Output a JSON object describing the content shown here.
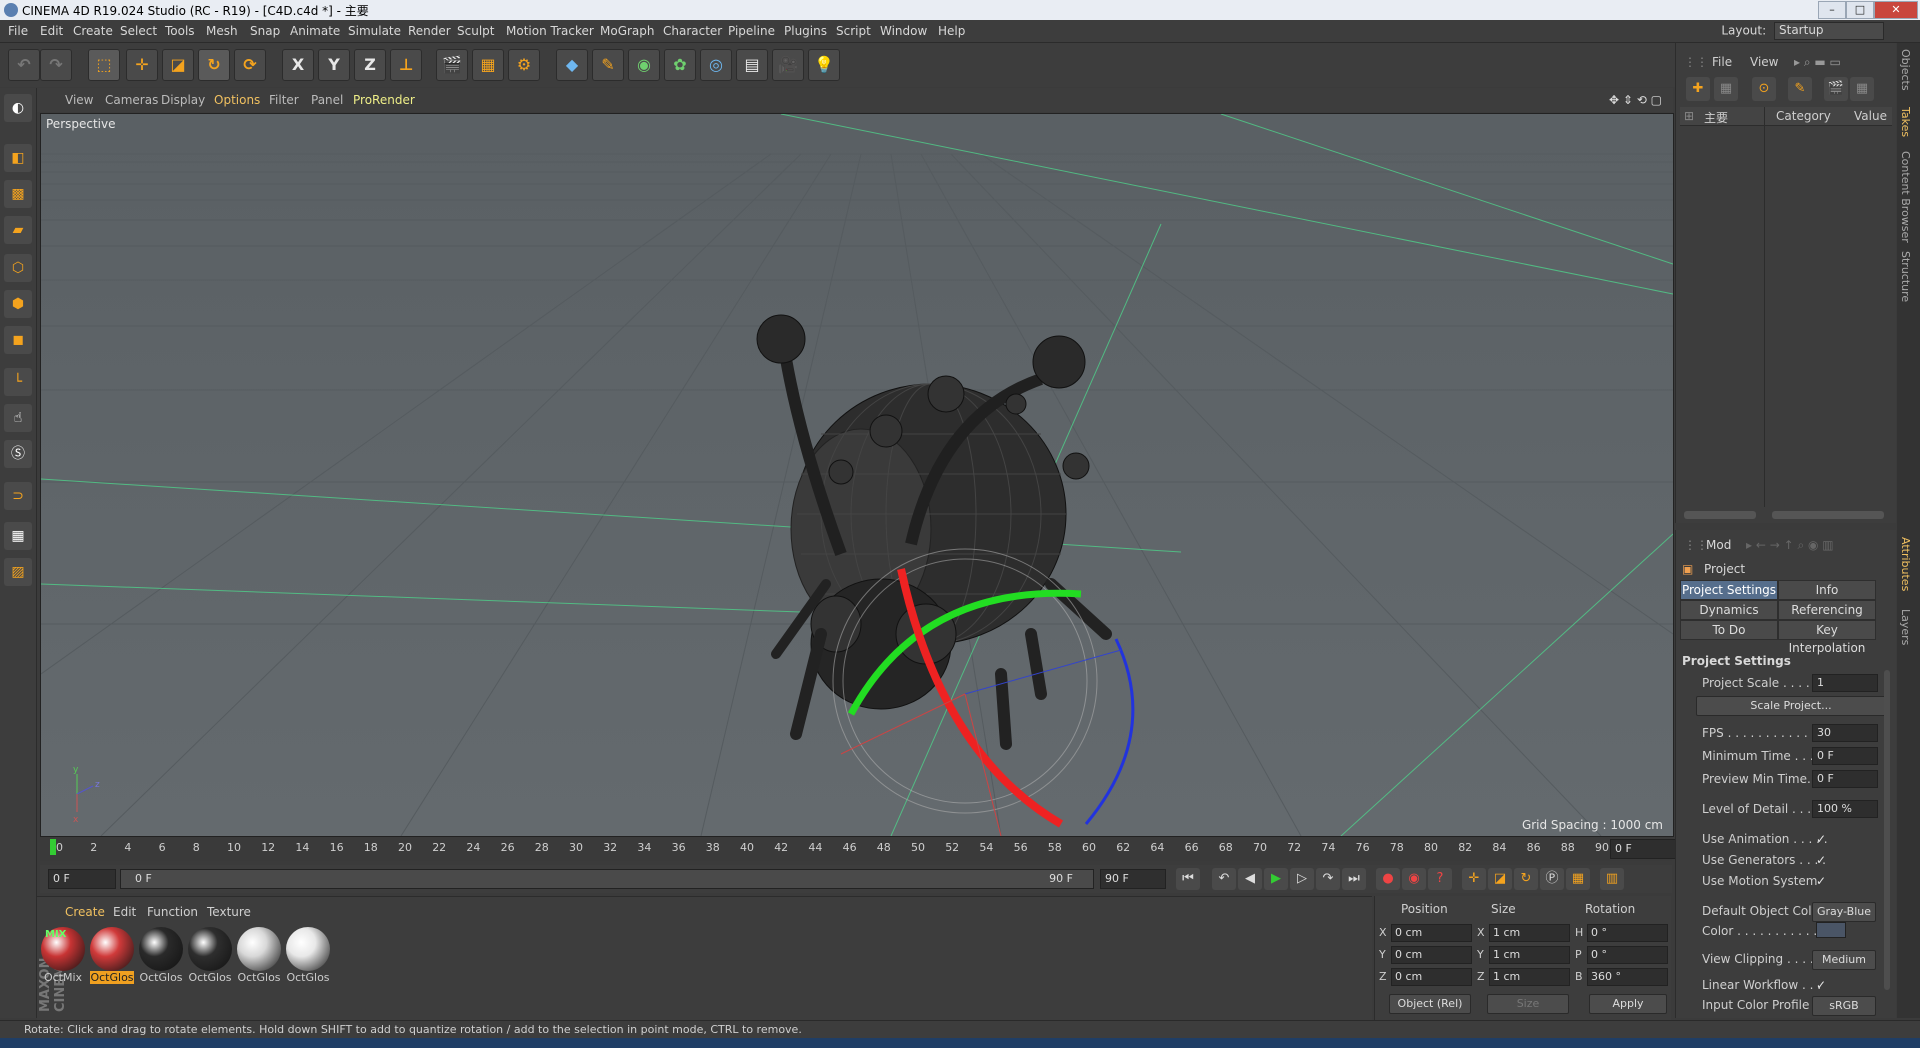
{
  "window": {
    "title": "CINEMA 4D R19.024 Studio (RC - R19) - [C4D.c4d *] - 主要",
    "minimize": "–",
    "maximize": "□",
    "close": "✕"
  },
  "menubar": {
    "items": [
      "File",
      "Edit",
      "Create",
      "Select",
      "Tools",
      "Mesh",
      "Snap",
      "Animate",
      "Simulate",
      "Render",
      "Sculpt",
      "Motion Tracker",
      "MoGraph",
      "Character",
      "Pipeline",
      "Plugins",
      "Script",
      "Window",
      "Help"
    ],
    "layout_label": "Layout:",
    "layout_value": "Startup"
  },
  "toolbar": {
    "axis_x": "X",
    "axis_y": "Y",
    "axis_z": "Z"
  },
  "viewport": {
    "menu": [
      "View",
      "Cameras",
      "Display",
      "Options",
      "Filter",
      "Panel",
      "ProRender"
    ],
    "active_menu": "Options",
    "label": "Perspective",
    "grid_spacing": "Grid Spacing : 1000 cm"
  },
  "timeline": {
    "ticks": [
      "0",
      "2",
      "4",
      "6",
      "8",
      "10",
      "12",
      "14",
      "16",
      "18",
      "20",
      "22",
      "24",
      "26",
      "28",
      "30",
      "32",
      "34",
      "36",
      "38",
      "40",
      "42",
      "44",
      "46",
      "48",
      "50",
      "52",
      "54",
      "56",
      "58",
      "60",
      "62",
      "64",
      "66",
      "68",
      "70",
      "72",
      "74",
      "76",
      "78",
      "80",
      "82",
      "84",
      "86",
      "88",
      "90"
    ],
    "end_frame": "0 F"
  },
  "transport": {
    "current_frame": "0 F",
    "range_start": "0 F",
    "range_end": "90 F",
    "max_frame": "90 F"
  },
  "material_manager": {
    "menu": [
      "Create",
      "Edit",
      "Function",
      "Texture"
    ],
    "brand": "MAXON CINEMA 4D",
    "materials": [
      {
        "label": "OctMix",
        "badge": "MIX",
        "color": "#c83434"
      },
      {
        "label": "OctGlos",
        "badge": "",
        "color": "#d03a3a"
      },
      {
        "label": "OctGlos",
        "badge": "",
        "color": "#2a2a2a"
      },
      {
        "label": "OctGlos",
        "badge": "",
        "color": "#2e2e2e"
      },
      {
        "label": "OctGlos",
        "badge": "",
        "color": "#d8d8d8"
      },
      {
        "label": "OctGlos",
        "badge": "",
        "color": "#e8e8e8"
      }
    ]
  },
  "coordinates": {
    "headers": [
      "Position",
      "Size",
      "Rotation"
    ],
    "rows": [
      {
        "pos_axis": "X",
        "pos": "0 cm",
        "size_axis": "X",
        "size": "1 cm",
        "rot_axis": "H",
        "rot": "0 °"
      },
      {
        "pos_axis": "Y",
        "pos": "0 cm",
        "size_axis": "Y",
        "size": "1 cm",
        "rot_axis": "P",
        "rot": "0 °"
      },
      {
        "pos_axis": "Z",
        "pos": "0 cm",
        "size_axis": "Z",
        "size": "1 cm",
        "rot_axis": "B",
        "rot": "360 °"
      }
    ],
    "mode": "Object (Rel)",
    "size_mode": "Size",
    "apply": "Apply"
  },
  "status": "Rotate: Click and drag to rotate elements. Hold down SHIFT to add to quantize rotation / add to the selection in point mode, CTRL to remove.",
  "object_manager": {
    "menu": [
      "File",
      "View"
    ],
    "col_name": "主要",
    "col_category": "Category",
    "col_value": "Value"
  },
  "attributes": {
    "mode": "Mod",
    "object": "Project",
    "tabs": [
      "Project Settings",
      "Info",
      "Dynamics",
      "Referencing",
      "To Do",
      "Key Interpolation"
    ],
    "section": "Project Settings",
    "fields": [
      {
        "label": "Project Scale . . . . . .",
        "value": "1"
      },
      {
        "label": "FPS . . . . . . . . . . . . .",
        "value": "30"
      },
      {
        "label": "Minimum Time . . . . .",
        "value": "0 F"
      },
      {
        "label": "Preview Min Time. . .",
        "value": "0 F"
      },
      {
        "label": "Level of Detail . . . . .",
        "value": "100 %"
      }
    ],
    "scale_button": "Scale Project...",
    "checks": [
      {
        "label": "Use Animation . . . . .",
        "value": "✓"
      },
      {
        "label": "Use Generators . . . .",
        "value": "✓"
      },
      {
        "label": "Use Motion System",
        "value": "✓"
      }
    ],
    "default_color_label": "Default Object Color",
    "default_color_value": "Gray-Blue",
    "color_label": "Color . . . . . . . . . . .",
    "view_clipping_label": "View Clipping . . . . .",
    "view_clipping_value": "Medium",
    "linear_workflow_label": "Linear Workflow . . .",
    "linear_workflow_value": "✓",
    "input_profile_label": "Input Color Profile . .",
    "input_profile_value": "sRGB"
  },
  "side_tabs": [
    "Objects",
    "Takes",
    "Content Browser",
    "Structure",
    "Attributes",
    "Layers"
  ]
}
